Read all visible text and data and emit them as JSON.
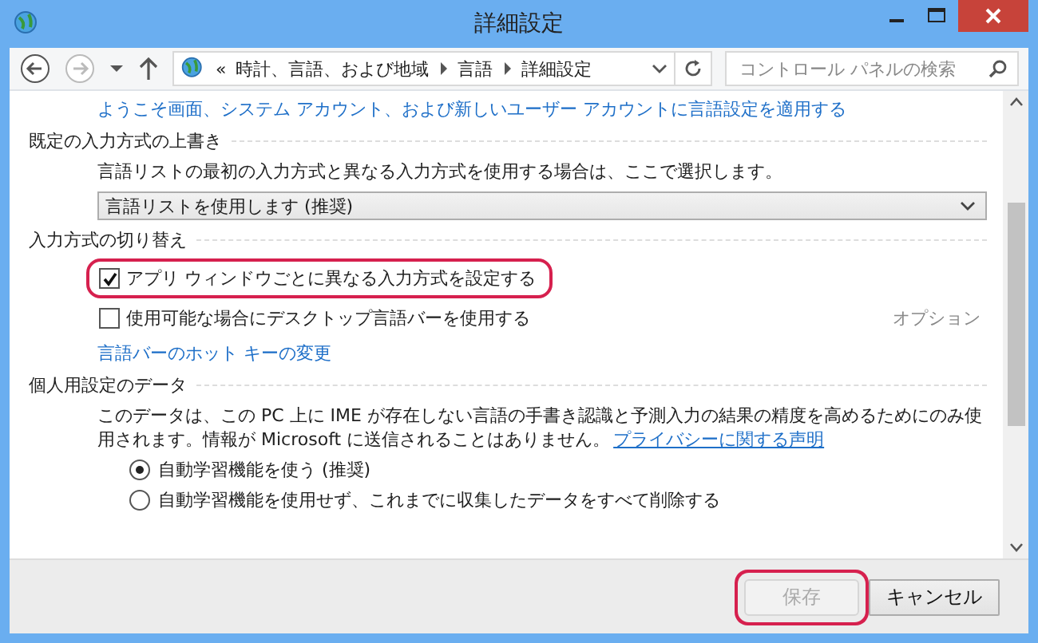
{
  "window": {
    "title": "詳細設定"
  },
  "nav": {
    "back_disabled": false,
    "forward_disabled": true,
    "breadcrumb_prefix": "«",
    "breadcrumb": [
      "時計、言語、および地域",
      "言語",
      "詳細設定"
    ],
    "search_placeholder": "コントロール パネルの検索"
  },
  "top_link": "ようこそ画面、システム アカウント、および新しいユーザー アカウントに言語設定を適用する",
  "sections": [
    {
      "heading": "既定の入力方式の上書き",
      "items": [
        {
          "kind": "text",
          "text": "言語リストの最初の入力方式と異なる入力方式を使用する場合は、ここで選択します。"
        },
        {
          "kind": "dropdown",
          "value": "言語リストを使用します (推奨)"
        }
      ]
    },
    {
      "heading": "入力方式の切り替え",
      "items": [
        {
          "kind": "checkbox",
          "label": "アプリ ウィンドウごとに異なる入力方式を設定する",
          "checked": true,
          "highlighted": true
        },
        {
          "kind": "checkbox",
          "label": "使用可能な場合にデスクトップ言語バーを使用する",
          "checked": false,
          "highlighted": false,
          "aside": "オプション"
        },
        {
          "kind": "link",
          "text": "言語バーのホット キーの変更"
        }
      ]
    },
    {
      "heading": "個人用設定のデータ",
      "items": [
        {
          "kind": "paragraph",
          "text": "このデータは、この PC 上に IME が存在しない言語の手書き認識と予測入力の結果の精度を高めるためにのみ使用されます。情報が Microsoft に送信されることはありません。",
          "link": "プライバシーに関する声明"
        },
        {
          "kind": "radio",
          "label": "自動学習機能を使う (推奨)",
          "selected": true
        },
        {
          "kind": "radio",
          "label": "自動学習機能を使用せず、これまでに収集したデータをすべて削除する",
          "selected": false
        }
      ]
    }
  ],
  "buttons": [
    {
      "label": "保存",
      "disabled": true,
      "highlighted": true
    },
    {
      "label": "キャンセル",
      "disabled": false,
      "highlighted": false
    }
  ]
}
